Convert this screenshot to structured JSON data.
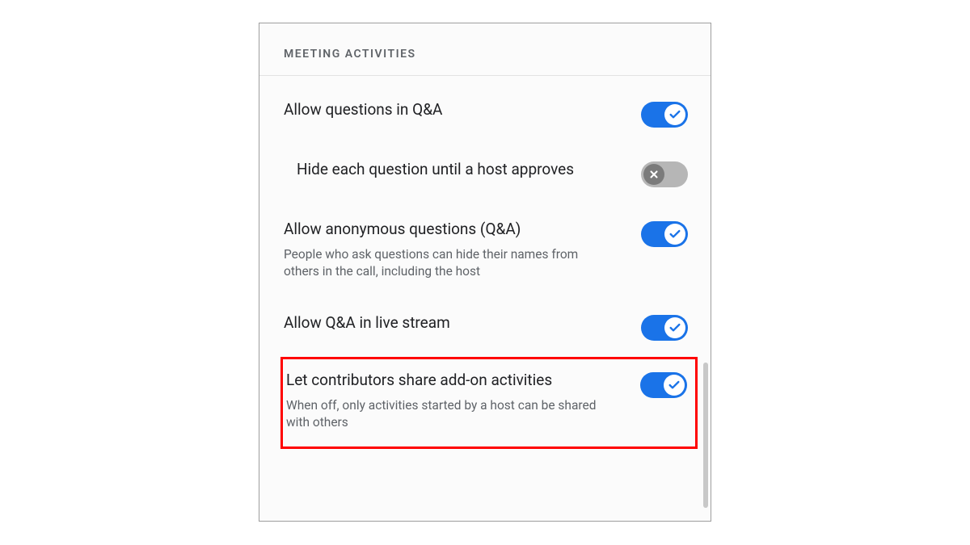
{
  "header": {
    "title": "MEETING ACTIVITIES"
  },
  "settings": {
    "allow_questions": {
      "label": "Allow questions in Q&A",
      "on": true
    },
    "hide_until_approved": {
      "label": "Hide each question until a host approves",
      "on": false
    },
    "allow_anonymous": {
      "label": "Allow anonymous questions (Q&A)",
      "desc": "People who ask questions can hide their names from others in the call, including the host",
      "on": true
    },
    "allow_live_stream": {
      "label": "Allow Q&A in live stream",
      "on": true
    },
    "contributors_share": {
      "label": "Let contributors share add-on activities",
      "desc": "When off, only activities started by a host can be shared with others",
      "on": true
    }
  },
  "colors": {
    "accent": "#1a73e8",
    "highlight": "#ff0000"
  }
}
